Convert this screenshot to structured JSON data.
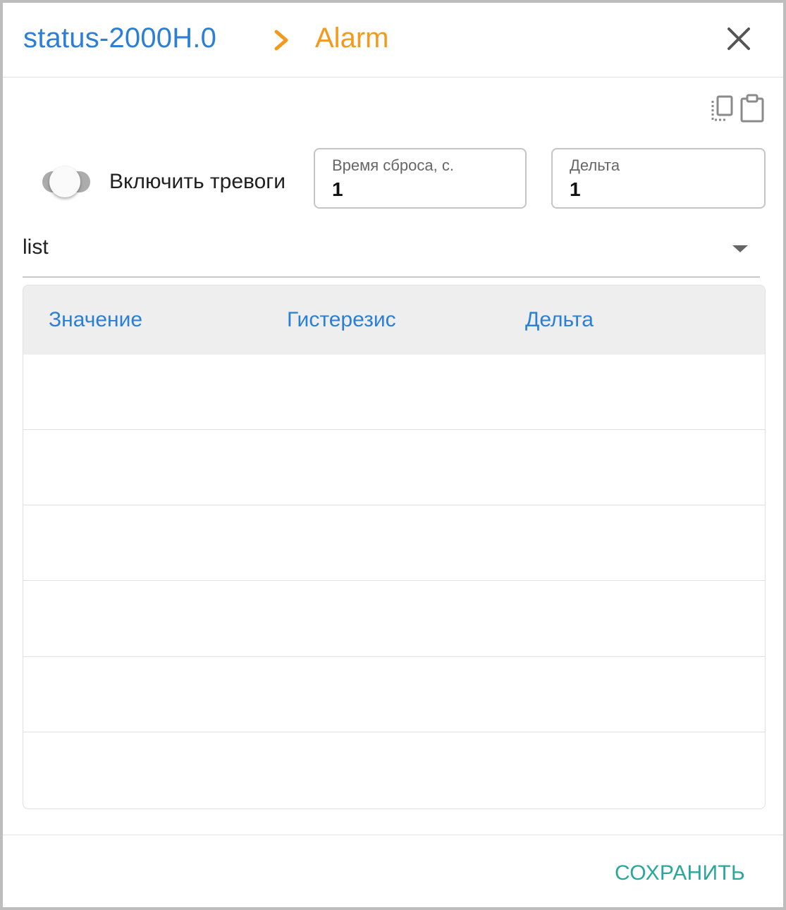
{
  "header": {
    "breadcrumb_root": "status-2000H.0",
    "breadcrumb_current": "Alarm",
    "separator_icon": "chevron-right-icon",
    "close_icon": "close-icon",
    "colors": {
      "root": "#2b7fd4",
      "current": "#f39a1e"
    }
  },
  "toolbar": {
    "copy_icon": "copy-icon",
    "paste_icon": "clipboard-icon"
  },
  "alarms": {
    "toggle_label": "Включить тревоги",
    "toggle_on": false,
    "reset_time": {
      "label": "Время сброса, с.",
      "value": "1"
    },
    "delta": {
      "label": "Дельта",
      "value": "1"
    }
  },
  "select": {
    "value": "list",
    "arrow_icon": "dropdown-arrow-icon"
  },
  "table": {
    "columns": [
      "Значение",
      "Гистерезис",
      "Дельта"
    ],
    "rows": [
      [
        "",
        "",
        ""
      ],
      [
        "",
        "",
        ""
      ],
      [
        "",
        "",
        ""
      ],
      [
        "",
        "",
        ""
      ],
      [
        "",
        "",
        ""
      ],
      [
        "",
        "",
        ""
      ]
    ]
  },
  "footer": {
    "save_label": "СОХРАНИТЬ",
    "accent_color": "#2aa79b"
  }
}
